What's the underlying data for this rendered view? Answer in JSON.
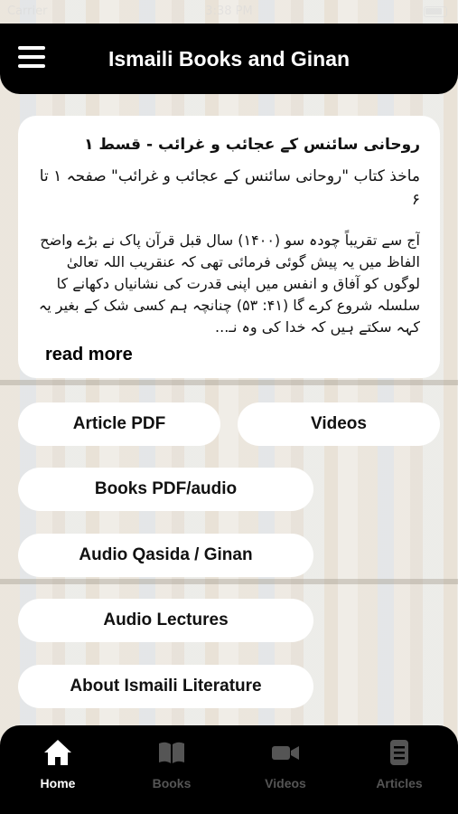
{
  "status_bar": {
    "carrier": "Carrier",
    "time": "3:38 PM"
  },
  "header": {
    "title": "Ismaili Books and Ginan"
  },
  "article": {
    "title": "روحانی سائنس کے عجائب و غرائب - قسط ۱",
    "source": "ماخذ کتاب \"روحانی سائنس کے عجائب و غرائب\" صفحہ ۱ تا ۶",
    "excerpt": "آج سے تقریباً چودہ سو (۱۴۰۰) سال قبل قرآن پاک نے بڑے واضح الفاظ میں یہ پیش گوئی فرمائی تھی کہ عنقریب اللہ تعالیٰ لوگوں کو آفاق و انفس میں اپنی قدرت کی نشانیاں دکھانے کا سلسلہ شروع کرے گا (۴۱: ۵۳) چنانچہ ہم کسی شک کے بغیر یہ کہہ سکتے ہیں کہ خدا کی وہ نـ...",
    "read_more": "read more"
  },
  "buttons": {
    "article_pdf": "Article PDF",
    "videos": "Videos",
    "books_pdf_audio": "Books PDF/audio",
    "audio_qasida_ginan": "Audio Qasida / Ginan",
    "audio_lectures": "Audio Lectures",
    "about": "About Ismaili Literature"
  },
  "tabs": [
    {
      "label": "Home",
      "icon": "home-icon",
      "active": true
    },
    {
      "label": "Books",
      "icon": "book-icon",
      "active": false
    },
    {
      "label": "Videos",
      "icon": "video-camera-icon",
      "active": false
    },
    {
      "label": "Articles",
      "icon": "document-icon",
      "active": false
    }
  ],
  "colors": {
    "header_bg": "#000000",
    "tab_active": "#ffffff",
    "tab_inactive": "#555555",
    "card_bg": "#ffffff"
  }
}
